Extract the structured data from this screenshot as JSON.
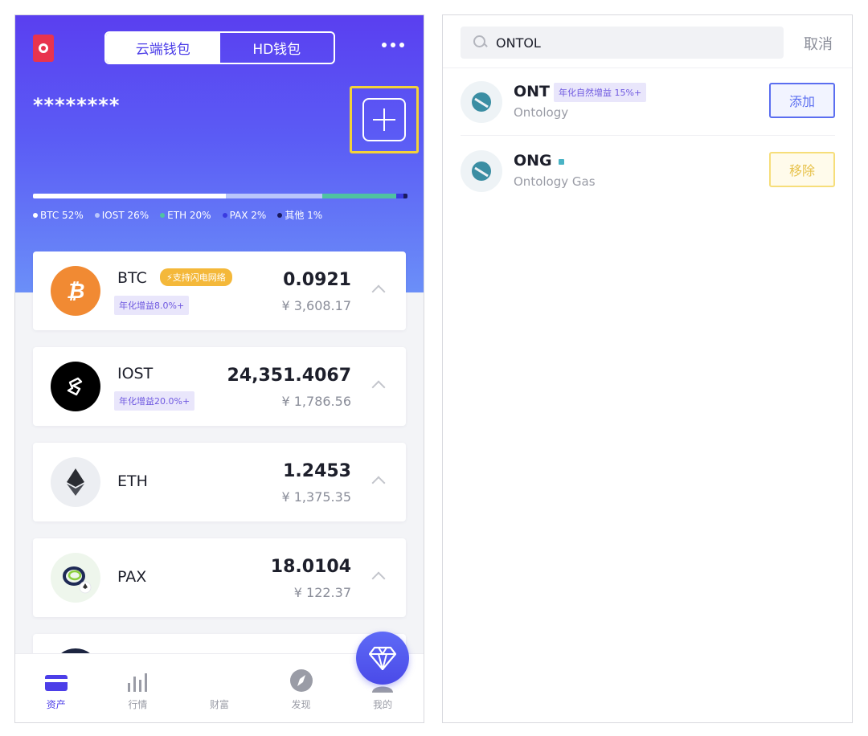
{
  "left": {
    "wallet_tabs": [
      {
        "label": "云端钱包",
        "active": true
      },
      {
        "label": "HD钱包",
        "active": false
      }
    ],
    "balance_masked": "********",
    "allocation": [
      {
        "label": "BTC 52%",
        "fraction": 0.52,
        "color": "#ffffff"
      },
      {
        "label": "IOST 26%",
        "fraction": 0.26,
        "color": "#b9c6fb"
      },
      {
        "label": "ETH 20%",
        "fraction": 0.2,
        "color": "#4fc3a1"
      },
      {
        "label": "PAX 2%",
        "fraction": 0.02,
        "color": "#3a3ae0"
      },
      {
        "label": "其他 1%",
        "fraction": 0.01,
        "color": "#1a1a5e"
      }
    ],
    "assets": [
      {
        "symbol": "BTC",
        "amount": "0.0921",
        "fiat": "¥ 3,608.17",
        "yield": "年化增益8.0%+",
        "lightning": "⚡支持闪电网络",
        "icon": "bitcoin-icon",
        "color": "#f18a33"
      },
      {
        "symbol": "IOST",
        "amount": "24,351.4067",
        "fiat": "¥ 1,786.56",
        "yield": "年化增益20.0%+",
        "icon": "iost-icon",
        "color": "#000000"
      },
      {
        "symbol": "ETH",
        "amount": "1.2453",
        "fiat": "¥ 1,375.35",
        "icon": "ethereum-icon",
        "color": "#eceef2"
      },
      {
        "symbol": "PAX",
        "amount": "18.0104",
        "fiat": "¥ 122.37",
        "icon": "pax-icon",
        "color": "#eef6ec"
      }
    ],
    "nav": [
      {
        "label": "资产",
        "icon": "wallet-card-icon",
        "active": true
      },
      {
        "label": "行情",
        "icon": "bar-chart-icon",
        "active": false
      },
      {
        "label": "财富",
        "icon": "diamond-icon",
        "active": false
      },
      {
        "label": "发现",
        "icon": "compass-icon",
        "active": false
      },
      {
        "label": "我的",
        "icon": "user-icon",
        "active": false
      }
    ],
    "accent": "#4c3ee8"
  },
  "right": {
    "search": {
      "value": "ONTOL",
      "cancel_label": "取消"
    },
    "results": [
      {
        "symbol": "ONT",
        "tag": "年化自然增益 15%+",
        "fullname": "Ontology",
        "action": "添加"
      },
      {
        "symbol": "ONG",
        "fullname": "Ontology Gas",
        "action": "移除"
      }
    ]
  }
}
